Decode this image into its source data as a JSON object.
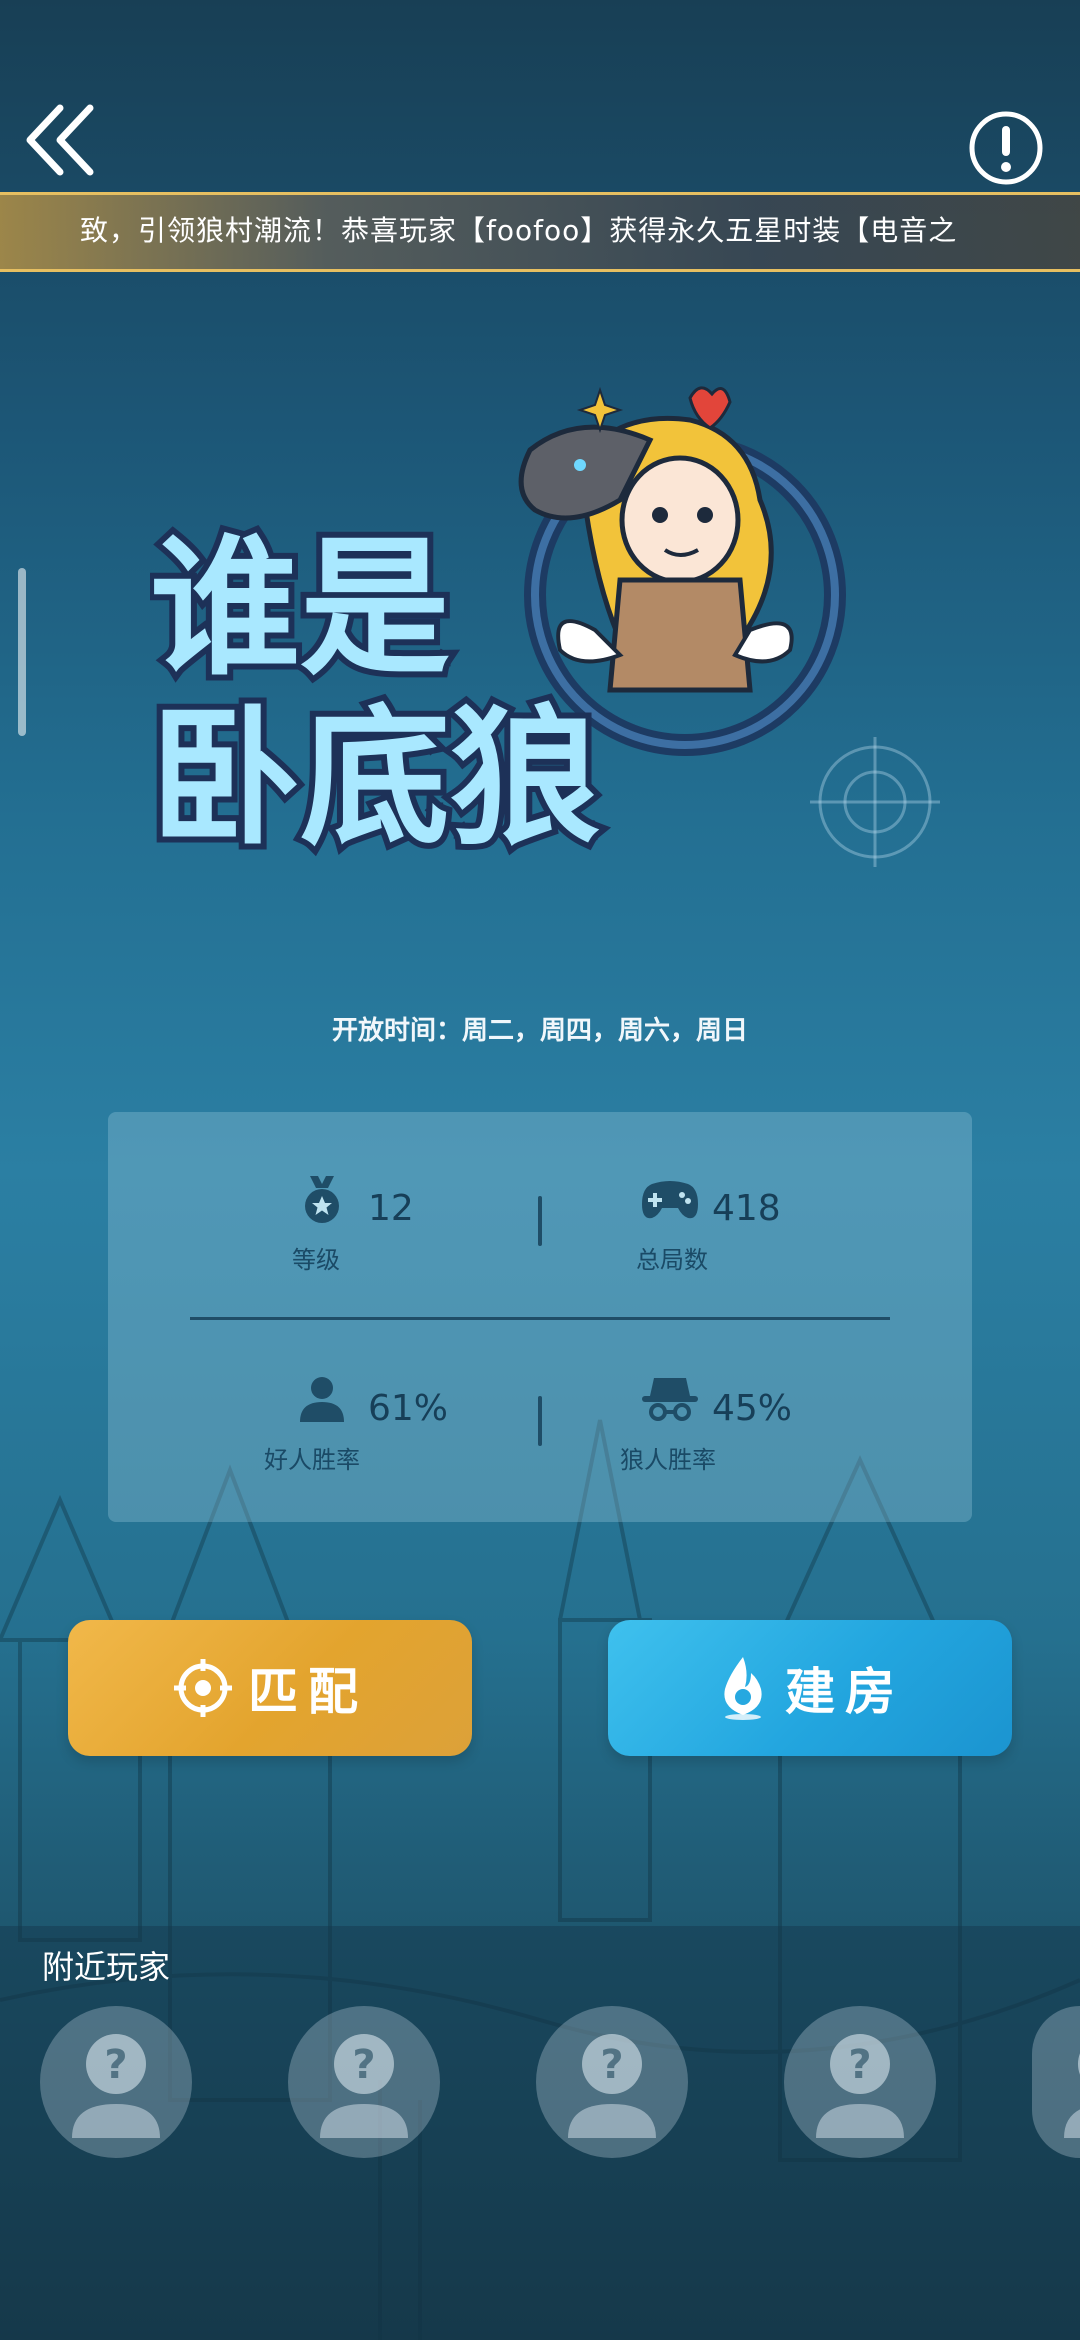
{
  "header": {
    "back_icon": "double-chevron-left-icon",
    "info_icon": "exclamation-circle-icon"
  },
  "ticker": {
    "text": "致，引领狼村潮流！恭喜玩家【foofoo】获得永久五星时装【电音之"
  },
  "logo": {
    "title_line1": "谁是",
    "title_line2": "卧底狼"
  },
  "schedule": {
    "text": "开放时间：周二，周四，周六，周日"
  },
  "stats": {
    "level": {
      "icon": "medal-icon",
      "value": "12",
      "label": "等级"
    },
    "total_games": {
      "icon": "gamepad-icon",
      "value": "418",
      "label": "总局数"
    },
    "good_win_rate": {
      "icon": "person-icon",
      "value": "61%",
      "label": "好人胜率"
    },
    "wolf_win_rate": {
      "icon": "spy-hat-icon",
      "value": "45%",
      "label": "狼人胜率"
    }
  },
  "buttons": {
    "match": {
      "label": "匹配",
      "icon": "target-icon",
      "color": "#e8aa32"
    },
    "create_room": {
      "label": "建房",
      "icon": "flame-icon",
      "color": "#26a8e0"
    }
  },
  "nearby": {
    "title": "附近玩家",
    "players": [
      {
        "icon": "unknown-player-icon"
      },
      {
        "icon": "unknown-player-icon"
      },
      {
        "icon": "unknown-player-icon"
      },
      {
        "icon": "unknown-player-icon"
      },
      {
        "icon": "unknown-player-icon"
      }
    ]
  }
}
